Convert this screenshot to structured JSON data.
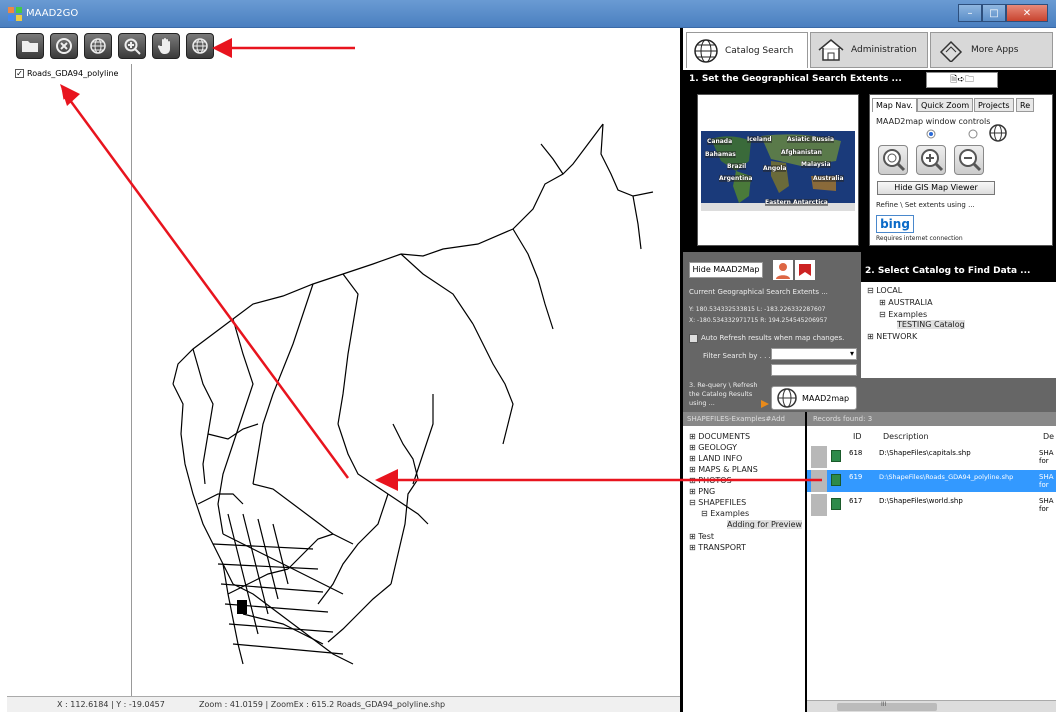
{
  "window": {
    "title": "MAAD2GO",
    "min": "–",
    "max": "□",
    "close": "✕"
  },
  "layers": {
    "items": [
      {
        "label": "Roads_GDA94_polyline",
        "checked": "✓"
      }
    ]
  },
  "statusbar": {
    "coords": "X : 112.6184 | Y : -19.0457",
    "zoom": "Zoom : 41.0159 | ZoomEx : 615.2 Roads_GDA94_polyline.shp"
  },
  "tabs": {
    "catalog_search": "Catalog Search",
    "administration": "Administration",
    "more_apps": "More Apps"
  },
  "section1": {
    "title": "1. Set the Geographical Search Extents ...",
    "nav": "🗎➪🗀"
  },
  "worldmap": {
    "labels": [
      "Canada",
      "Iceland",
      "Asiatic Russia",
      "Bahamas",
      "Afghanistan",
      "Brazil",
      "Angola",
      "Malaysia",
      "Argentina",
      "Australia",
      "Eastern Antarctica"
    ]
  },
  "mapnav": {
    "tabs": [
      "Map Nav.",
      "Quick Zoom",
      "Projects",
      "Re"
    ],
    "window_controls": "MAAD2map window controls",
    "hide_gis": "Hide GIS Map Viewer",
    "refine": "Refine \\ Set extents using ...",
    "bing": "bing",
    "requires": "Requires internet connection"
  },
  "search": {
    "hide_maad": "Hide MAAD2Map",
    "current_extents": "Current Geographical Search Extents ...",
    "coord1": "Y: 180.534332533815   L: -183.226332287607",
    "coord2": "X: -180.534332971715   R: 194.254545206957",
    "auto_refresh": "Auto Refresh results when map changes.",
    "filter": "Filter Search by . . ."
  },
  "section2": {
    "title": "2. Select Catalog to Find Data ..."
  },
  "catalog_tree": [
    "⊟ LOCAL",
    "⊞ AUSTRALIA",
    "⊟ Examples",
    "TESTING Catalog",
    "⊞ NETWORK"
  ],
  "requery": {
    "text": "3. Re-query \\ Refresh the Catalog Results using ...",
    "button": "MAAD2map"
  },
  "tree_header": "SHAPEFILES-Examples#Add",
  "records_header": "Records found: 3",
  "shape_tree": [
    "⊞ DOCUMENTS",
    "⊞ GEOLOGY",
    "⊞ LAND INFO",
    "⊞ MAPS & PLANS",
    "⊞ PHOTOS",
    "⊞ PNG",
    "⊟ SHAPEFILES",
    "⊟ Examples",
    "Adding for Preview",
    "⊞ Test",
    "⊞ TRANSPORT"
  ],
  "records": {
    "columns": [
      "ID",
      "Description",
      "De"
    ],
    "rows": [
      {
        "id": "618",
        "desc": "D:\\ShapeFiles\\capitals.shp",
        "de1": "SHA",
        "de2": "for"
      },
      {
        "id": "619",
        "desc": "D:\\ShapeFiles\\Roads_GDA94_polyline.shp",
        "de1": "SHA",
        "de2": "for"
      },
      {
        "id": "617",
        "desc": "D:\\ShapeFiles\\world.shp",
        "de1": "SHA",
        "de2": "for"
      }
    ],
    "scroll": "III"
  },
  "colors": {
    "annotation_arrow": "#e8141e",
    "selection": "#3399ff",
    "panel_grey": "#666666"
  }
}
